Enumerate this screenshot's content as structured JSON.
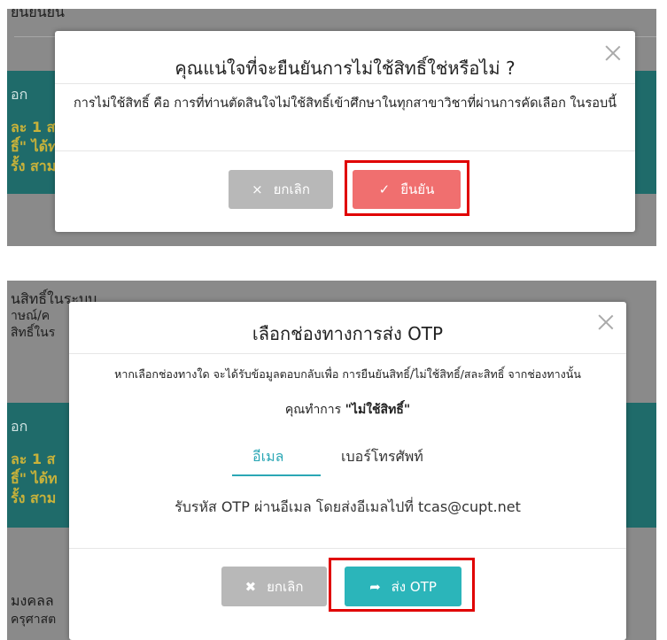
{
  "top": {
    "background": {
      "header_fragment": "ยินยันยืน",
      "teal_lines": [
        "อก",
        "ละ 1 ส",
        "ธิ์\" ได้ท",
        "รั้ง สาม"
      ]
    },
    "modal": {
      "title": "คุณแน่ใจที่จะยืนยันการไม่ใช้สิทธิ์ใช่หรือไม่ ?",
      "message": "การไม่ใช้สิทธิ์ คือ การที่ท่านตัดสินใจไม่ใช้สิทธิ์เข้าศึกษาในทุกสาขาวิชาที่ผ่านการคัดเลือก ในรอบนี้",
      "cancel_label": "ยกเลิก",
      "confirm_label": "ยืนยัน",
      "cancel_icon": "×",
      "confirm_icon": "✓"
    }
  },
  "bottom": {
    "background": {
      "top_lines": [
        "นสิทธิ์ในระบบ",
        "าษณ์/ค",
        "สิทธิ์ในร"
      ],
      "teal_lines": [
        "อก",
        "ละ 1 ส",
        "ธิ์\" ได้ท",
        "รั้ง สาม"
      ],
      "bottom_lines": [
        "มงคลล",
        "ครุศาสต"
      ]
    },
    "modal": {
      "title": "เลือกช่องทางการส่ง OTP",
      "instruction": "หากเลือกช่องทางใด จะได้รับข้อมูลตอบกลับเพื่อ การยืนยันสิทธิ์/ไม่ใช้สิทธิ์/สละสิทธิ์ จากช่องทางนั้น",
      "action_prefix": "คุณทำการ",
      "action_value": "\"ไม่ใช้สิทธิ์\"",
      "tabs": [
        "อีเมล",
        "เบอร์โทรศัพท์"
      ],
      "active_tab": "อีเมล",
      "otp_prefix": "รับรหัส OTP ผ่านอีเมล โดยส่งอีเมลไปที่",
      "otp_email": "tcas@cupt.net",
      "cancel_label": "ยกเลิก",
      "send_label": "ส่ง OTP",
      "cancel_icon": "✖",
      "send_icon": "➦"
    }
  },
  "colors": {
    "overlay": "#8a8a8a",
    "teal_band": "#1f6b6a",
    "confirm": "#f06f6f",
    "send": "#2bb5ba",
    "cancel": "#b8b8b8",
    "highlight": "#e00000",
    "tab_active": "#2ba7b5"
  }
}
